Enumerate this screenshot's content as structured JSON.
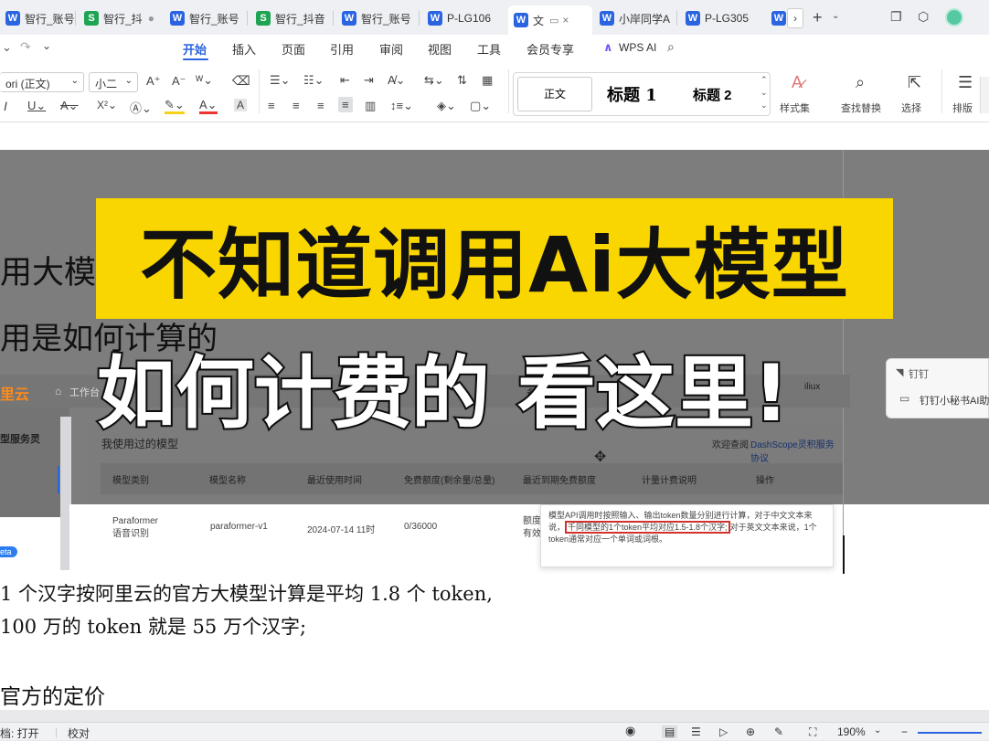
{
  "tabs": [
    {
      "label": "智行_账号",
      "type": "W"
    },
    {
      "label": "智行_抖",
      "type": "S"
    },
    {
      "label": "智行_账号",
      "type": "W"
    },
    {
      "label": "智行_抖音",
      "type": "S"
    },
    {
      "label": "智行_账号",
      "type": "W"
    },
    {
      "label": "P-LG106",
      "type": "W"
    },
    {
      "label": "文",
      "type": "W"
    },
    {
      "label": "小岸同学A",
      "type": "W"
    },
    {
      "label": "P-LG305",
      "type": "W"
    }
  ],
  "menus": [
    "开始",
    "插入",
    "页面",
    "引用",
    "审阅",
    "视图",
    "工具",
    "会员专享"
  ],
  "wps_ai": "WPS AI",
  "ribbon": {
    "font_name": "ori (正文)",
    "font_size": "小二",
    "styles": [
      "正文",
      "标题 1",
      "标题 2"
    ],
    "style_set": "样式集",
    "find_replace": "查找替换",
    "select": "选择",
    "layout": "排版"
  },
  "doc": {
    "heading1": "用大模",
    "heading2": "用是如何计算的",
    "line1": "1 个汉字按阿里云的官方大模型计算是平均 1.8 个 token,",
    "line2": "100 万的 token 就是  55 万个汉字;",
    "line3": "官方的定价"
  },
  "screenshot": {
    "brand": "里云",
    "workspace": "工作台",
    "side_title": "型服务灵",
    "beta": "eta",
    "beian": "备案",
    "dan": "单",
    "iliux": "iliux",
    "section_title": "我使用过的模型",
    "link_prefix": "欢迎查阅",
    "link": "DashScope灵积服务协议",
    "columns": [
      "模型类别",
      "模型名称",
      "最近使用时间",
      "免费额度(剩余量/总量)",
      "最近到期免费额度",
      "计量计费说明",
      "操作"
    ],
    "row": {
      "category": "Paraformer语音识别",
      "name": "paraformer-v1",
      "time": "2024-07-14 11时",
      "quota": "0/36000",
      "expire": "额度有效"
    },
    "tooltip_a": "模型API调用时按照输入、输出token数量分别进行计算，对于中文文本来说，",
    "tooltip_highlight": "千同模型的1个token平均对应1.5-1.8个汉字;",
    "tooltip_b": "对于英文文本来说，1个token通常对应一个单词或词根。"
  },
  "dingtalk": {
    "title": "钉钉",
    "item": "钉钉小秘书AI助"
  },
  "overlay": {
    "line1": "不知道调用Ai大模型",
    "line2": "如何计费的 看这里!"
  },
  "status": {
    "left": "档: 打开",
    "proof": "校对",
    "zoom": "190%"
  }
}
